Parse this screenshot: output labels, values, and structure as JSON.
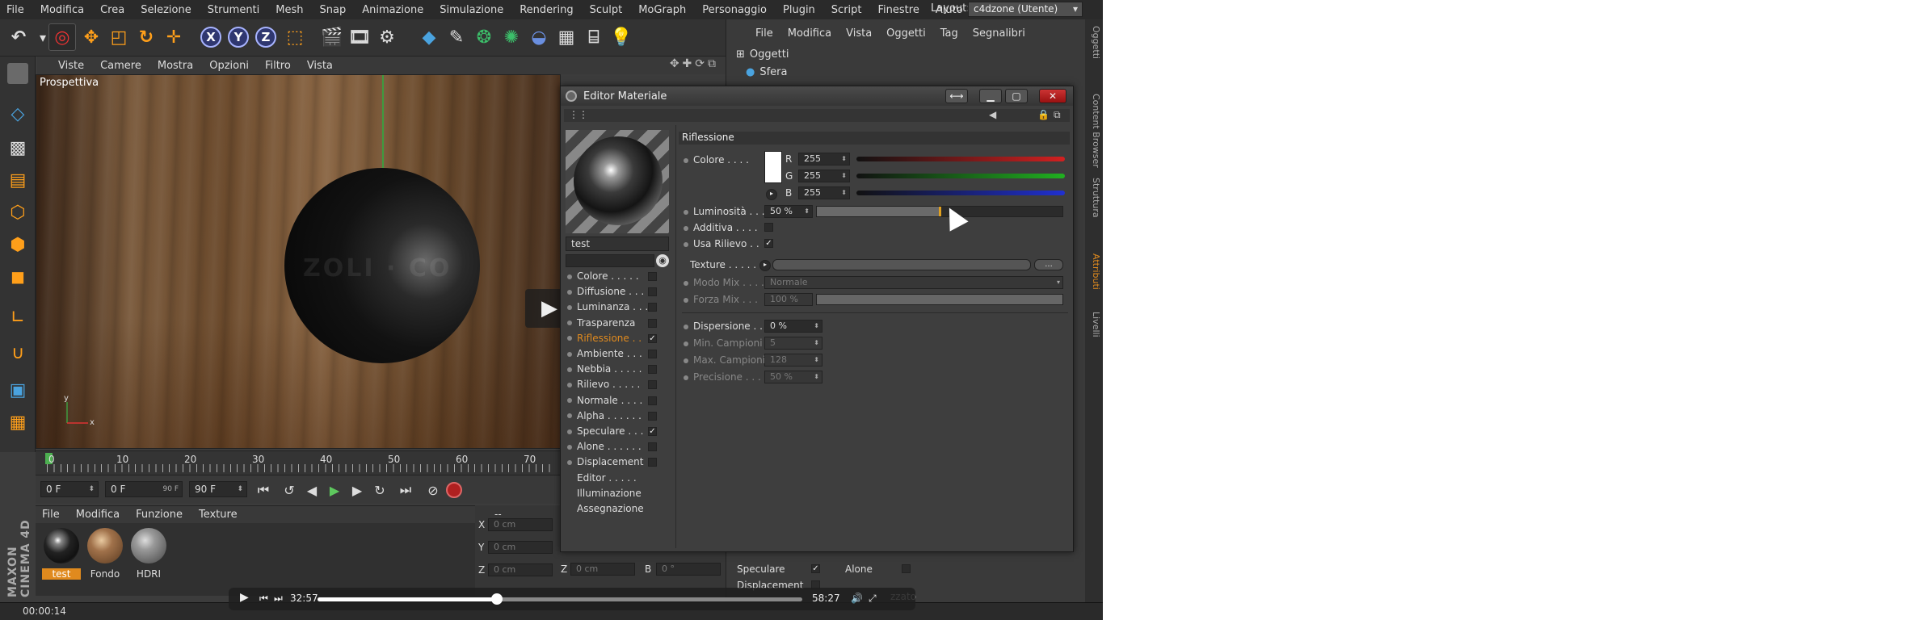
{
  "menubar": {
    "items": [
      "File",
      "Modifica",
      "Crea",
      "Selezione",
      "Strumenti",
      "Mesh",
      "Snap",
      "Animazione",
      "Simulazione",
      "Rendering",
      "Sculpt",
      "MoGraph",
      "Personaggio",
      "Plugin",
      "Script",
      "Finestre",
      "Aiuto"
    ],
    "layout_label": "Layout:",
    "layout_value": "c4dzone (Utente)"
  },
  "toolbar": {
    "axis_x": "X",
    "axis_y": "Y",
    "axis_z": "Z"
  },
  "viewport": {
    "menu": [
      "Viste",
      "Camere",
      "Mostra",
      "Opzioni",
      "Filtro",
      "Vista"
    ],
    "label": "Prospettiva",
    "watermark": "ZOLI · CO",
    "axis_y": "y",
    "axis_x": "x"
  },
  "timeline": {
    "ticks": [
      "0",
      "10",
      "20",
      "30",
      "40",
      "50",
      "60",
      "70"
    ]
  },
  "transport": {
    "start_frame": "0 F",
    "current_frame": "0 F",
    "end_frame_inner": "90 F",
    "end_frame": "90 F"
  },
  "material_manager": {
    "menu": [
      "File",
      "Modifica",
      "Funzione",
      "Texture"
    ],
    "materials": [
      {
        "name": "test",
        "selected": true
      },
      {
        "name": "Fondo",
        "selected": false
      },
      {
        "name": "HDRI",
        "selected": false
      }
    ]
  },
  "brand": "MAXON CINEMA 4D",
  "coordinates": {
    "header": "--",
    "rows": [
      {
        "label": "X",
        "value": "0 cm"
      },
      {
        "label": "Y",
        "value": "0 cm"
      },
      {
        "label": "Z",
        "value": "0 cm"
      }
    ],
    "z2_label": "Z",
    "z2_value": "0 cm",
    "b_label": "B",
    "b_value": "0 °"
  },
  "object_manager": {
    "menu": [
      "File",
      "Modifica",
      "Vista",
      "Oggetti",
      "Tag",
      "Segnalibri"
    ],
    "objects": [
      "Oggetti",
      "Sfera"
    ]
  },
  "side_tabs": [
    "Oggetti",
    "Content Browser",
    "Struttura",
    "Attributi",
    "Livelli"
  ],
  "attributes_bottom": {
    "speculare": "Speculare",
    "alone": "Alone",
    "displacement": "Displacement",
    "caption": "zzato"
  },
  "status": {
    "time": "00:00:14"
  },
  "dialog": {
    "title": "Editor Materiale",
    "material_name": "test",
    "channels": [
      {
        "label": "Colore . . . . .",
        "checked": false,
        "active": false
      },
      {
        "label": "Diffusione . . .",
        "checked": false,
        "active": false
      },
      {
        "label": "Luminanza . . .",
        "checked": false,
        "active": false
      },
      {
        "label": "Trasparenza",
        "checked": false,
        "active": false
      },
      {
        "label": "Riflessione . .",
        "checked": true,
        "active": true
      },
      {
        "label": "Ambiente . . .",
        "checked": false,
        "active": false
      },
      {
        "label": "Nebbia . . . . .",
        "checked": false,
        "active": false
      },
      {
        "label": "Rilievo . . . . .",
        "checked": false,
        "active": false
      },
      {
        "label": "Normale . . . .",
        "checked": false,
        "active": false
      },
      {
        "label": "Alpha . . . . . .",
        "checked": false,
        "active": false
      },
      {
        "label": "Speculare . . .",
        "checked": true,
        "active": false
      },
      {
        "label": "Alone . . . . . .",
        "checked": false,
        "active": false
      },
      {
        "label": "Displacement",
        "checked": false,
        "active": false
      }
    ],
    "plain_items": [
      "Editor . . . . .",
      "Illuminazione",
      "Assegnazione"
    ],
    "section": "Riflessione",
    "colore_label": "Colore . . . .",
    "r_label": "R",
    "r_value": "255",
    "g_label": "G",
    "g_value": "255",
    "b_label": "B",
    "b_value": "255",
    "luminosita_label": "Luminosità . . .",
    "luminosita_value": "50 %",
    "luminosita_fraction": 0.5,
    "additiva_label": "Additiva . . . .",
    "usa_rilievo_label": "Usa Rilievo . .",
    "texture_label": "Texture . . . . .",
    "texture_button": "...",
    "modo_mix_label": "Modo Mix . . . .",
    "modo_mix_value": "Normale",
    "forza_mix_label": "Forza Mix . . .",
    "forza_mix_value": "100 %",
    "dispersione_label": "Dispersione . . .",
    "dispersione_value": "0 %",
    "min_campioni_label": "Min. Campioni",
    "min_campioni_value": "5",
    "max_campioni_label": "Max. Campioni",
    "max_campioni_value": "128",
    "precisione_label": "Precisione . . .",
    "precisione_value": "50 %"
  },
  "video_player": {
    "elapsed": "32:57",
    "total": "58:27",
    "progress_fraction": 0.37
  },
  "colors": {
    "accent": "#e08a1e",
    "red_slider": "#d22020",
    "green_slider": "#20b020",
    "blue_slider": "#2030d0"
  }
}
